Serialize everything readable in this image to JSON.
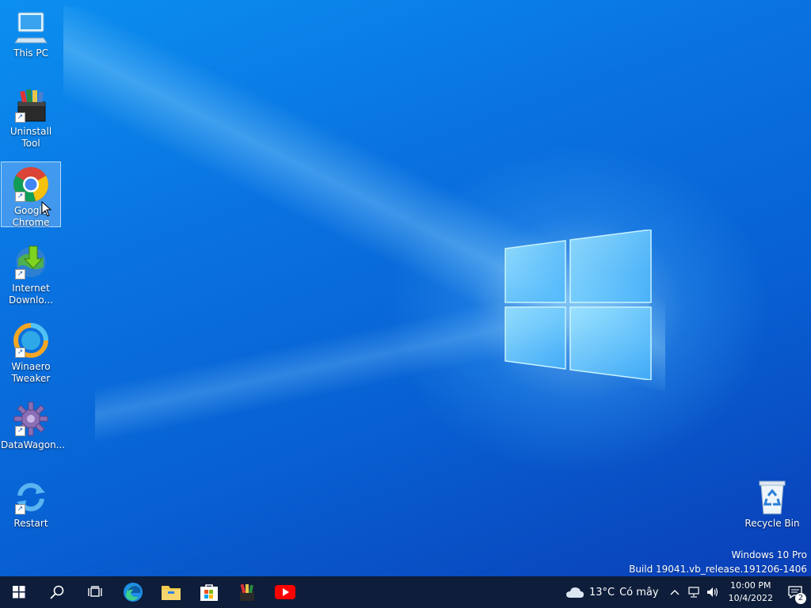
{
  "desktop": {
    "icons": [
      {
        "label": "This PC"
      },
      {
        "label": "Uninstall Tool"
      },
      {
        "label": "Google Chrome"
      },
      {
        "label": "Internet Downlo..."
      },
      {
        "label": "Winaero Tweaker"
      },
      {
        "label": "DataWagon..."
      },
      {
        "label": "Restart"
      }
    ],
    "recycle_bin": {
      "label": "Recycle Bin"
    },
    "watermark": {
      "edition": "Windows 10 Pro",
      "build": "Build 19041.vb_release.191206-1406"
    }
  },
  "taskbar": {
    "pinned": [
      "start-icon",
      "search-icon",
      "task-view-icon",
      "edge-icon",
      "file-explorer-icon",
      "store-icon",
      "uninstall-tool-icon",
      "youtube-icon"
    ],
    "weather": {
      "temp": "13°C",
      "condition": "Có mây"
    },
    "clock": {
      "time": "10:00 PM",
      "date": "10/4/2022"
    },
    "notifications": {
      "count": "2"
    }
  },
  "colors": {
    "taskbar": "#0d1d3a",
    "accent": "#0a72e0"
  }
}
